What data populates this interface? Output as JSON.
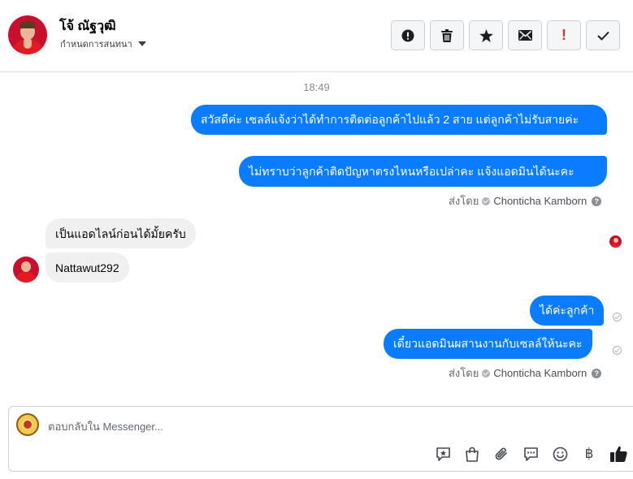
{
  "header": {
    "contact_name": "โจ้ ณัฐวุฒิ",
    "contact_subtitle": "กำหนดการสนทนา",
    "toolbar": {
      "spam_icon": "exclamation-circle-icon",
      "delete_icon": "trash-icon",
      "star_icon": "star-icon",
      "mail_icon": "envelope-icon",
      "flag_icon": "red-exclamation-icon",
      "done_icon": "check-icon"
    },
    "flag_symbol": "!",
    "flag_color": "#e4312b"
  },
  "chat": {
    "timestamp": "18:49",
    "outgoing_group_1": {
      "messages": [
        "สวัสดีค่ะ เซลล์แจ้งว่าได้ทำการติดต่อลูกค้าไปแล้ว 2 สาย แต่ลูกค้าไม่รับสายค่ะ",
        "ไม่ทราบว่าลูกค้าติดปัญหาตรงไหนหรือเปล่าคะ แจ้งแอดมินได้นะคะ"
      ],
      "sent_by_label": "ส่งโดย",
      "sent_by_name": "Chonticha Kamborn"
    },
    "incoming_group": {
      "messages": [
        "เป็นแอดไลน์ก่อนได้มั้ยครับ",
        "Nattawut292"
      ]
    },
    "outgoing_group_2": {
      "messages": [
        "ได้ค่ะลูกค้า",
        "เดี๋ยวแอดมินผสานงานกับเซลล์ให้นะคะ"
      ],
      "sent_by_label": "ส่งโดย",
      "sent_by_name": "Chonticha Kamborn"
    },
    "outgoing_color": "#0a7cff",
    "incoming_color": "#f0f0f0"
  },
  "composer": {
    "placeholder": "ตอบกลับใน Messenger...",
    "tools": [
      "saved-reply-icon",
      "shopping-bag-icon",
      "paperclip-icon",
      "chat-bubble-icon",
      "smiley-icon",
      "baht-icon",
      "thumbs-up-icon"
    ],
    "baht_symbol": "฿"
  }
}
